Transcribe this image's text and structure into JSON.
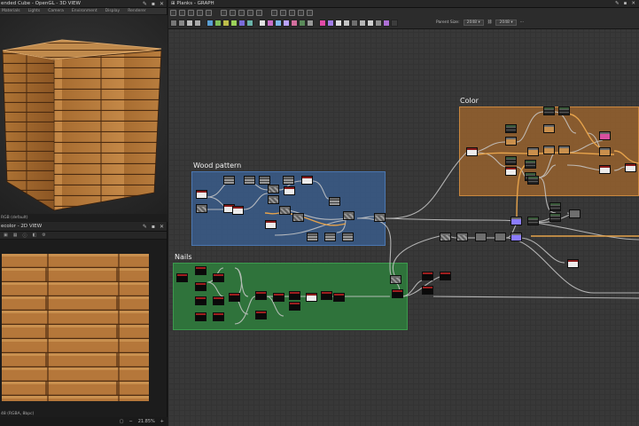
{
  "view3d": {
    "title": "ended Cube - OpenGL - 3D VIEW",
    "menu": [
      "Materials",
      "Lights",
      "Camera",
      "Environment",
      "Display",
      "Renderer"
    ],
    "status": "RGB (default)"
  },
  "view2d": {
    "title": "ecolor - 2D VIEW",
    "status": "48 (RGBA, 8bpc)",
    "zoom": "21.85%"
  },
  "graph": {
    "title": "Planks - GRAPH",
    "parent_size_label": "Parent Size:",
    "parent_size_w": "2048",
    "parent_size_h": "2048",
    "frames": [
      {
        "label": "Color",
        "color": "#a8692d"
      },
      {
        "label": "Wood pattern",
        "color": "#3a5c8a"
      },
      {
        "label": "Nails",
        "color": "#2f7a3c"
      }
    ]
  },
  "colors": {
    "wood_light": "#c48847",
    "wood_dark": "#7a4a23",
    "link_white": "#c9c9c9",
    "link_orange": "#e5a24b"
  }
}
